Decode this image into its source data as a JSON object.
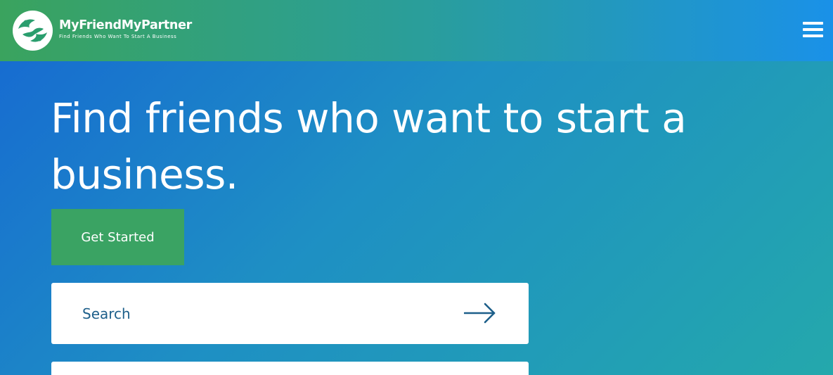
{
  "header": {
    "brand_name": "MyFriendMyPartner",
    "tagline": "Find Friends Who Want To Start A Business",
    "logo_icon": "handshake-logo-icon",
    "menu_icon": "hamburger-menu-icon"
  },
  "hero": {
    "headline": "Find friends who want to start a business.",
    "cta_label": "Get Started"
  },
  "search": {
    "placeholder": "Search",
    "submit_icon": "arrow-right-icon"
  },
  "colors": {
    "header_gradient": [
      "#3aa35e",
      "#2a9e9a",
      "#1a91e8"
    ],
    "hero_gradient": [
      "#1668d2",
      "#1e8fc4",
      "#24a8ac"
    ],
    "cta_background": "#3aa363",
    "search_text": "#1d5f8a"
  }
}
